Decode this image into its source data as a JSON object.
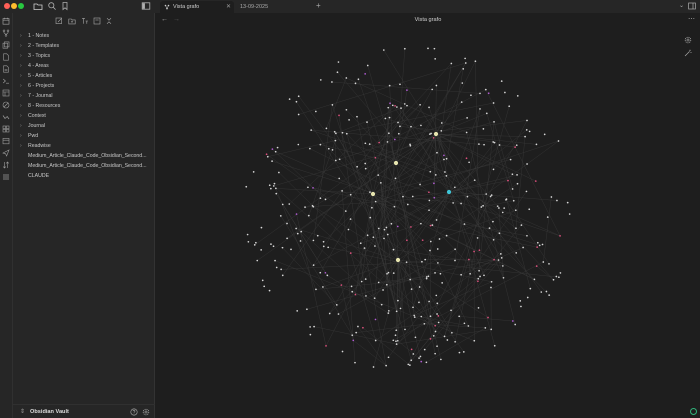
{
  "tabs": {
    "active": {
      "label": "Vista grafo",
      "icon": "graph-icon"
    },
    "inactive": {
      "label": "13-09-2025"
    }
  },
  "sidebar": {
    "tree": [
      {
        "label": "1 - Notes",
        "type": "folder"
      },
      {
        "label": "2 - Templates",
        "type": "folder"
      },
      {
        "label": "3 - Topics",
        "type": "folder"
      },
      {
        "label": "4 - Areas",
        "type": "folder"
      },
      {
        "label": "5 - Articles",
        "type": "folder"
      },
      {
        "label": "6 - Projects",
        "type": "folder"
      },
      {
        "label": "7 - Journal",
        "type": "folder"
      },
      {
        "label": "8 - Resources",
        "type": "folder"
      },
      {
        "label": "Context",
        "type": "folder"
      },
      {
        "label": "Journal",
        "type": "folder"
      },
      {
        "label": "Pwd",
        "type": "folder"
      },
      {
        "label": "Readwise",
        "type": "folder"
      },
      {
        "label": "Medium_Article_Claude_Code_Obsidian_Second...",
        "type": "file"
      },
      {
        "label": "Medium_Article_Claude_Code_Obsidian_Second...",
        "type": "file"
      },
      {
        "label": "CLAUDE",
        "type": "file"
      }
    ],
    "vault_name": "Obsidian Vault"
  },
  "view": {
    "title": "Vista grafo"
  },
  "colors": {
    "background": "#1e1e1e",
    "panel": "#262626",
    "node": "#d9d9d9",
    "node_tag": "#e0517f",
    "node_attachment": "#b45dd6",
    "node_highlight": "#3ec6d8",
    "node_hub": "#e8e6b0",
    "edge": "#3c3c3c",
    "sync": "#2fb37a"
  },
  "icons": {
    "titlebar": [
      "folder-icon",
      "search-icon",
      "bookmark-icon",
      "sidebar-toggle-icon"
    ],
    "ribbon": [
      "calendar-icon",
      "fork-icon",
      "copy-icon",
      "file-icon",
      "file-icon",
      "terminal-icon",
      "template-icon",
      "canvas-icon",
      "graph-icon",
      "layout-icon",
      "send-icon",
      "sort-icon",
      "list-icon"
    ]
  }
}
